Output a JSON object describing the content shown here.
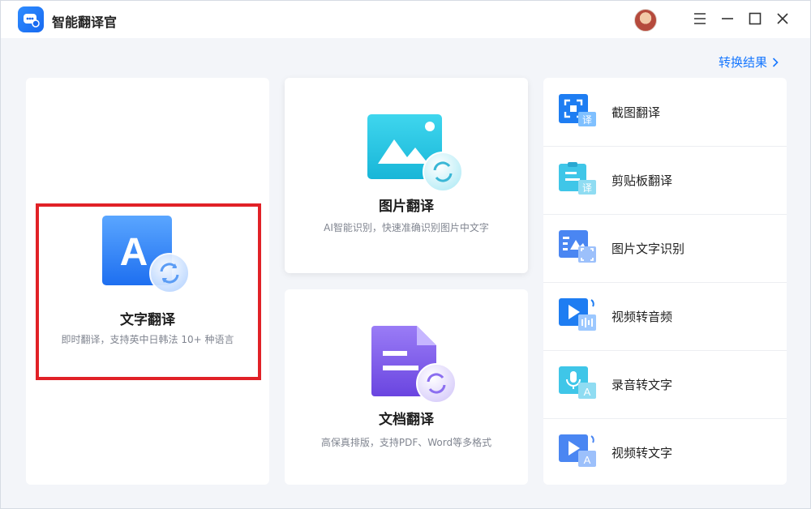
{
  "app": {
    "title": "智能翻译官"
  },
  "header": {
    "result_link": "转换结果"
  },
  "cards": {
    "text": {
      "title": "文字翻译",
      "subtitle": "即时翻译，支持英中日韩法 10+ 种语言"
    },
    "image": {
      "title": "图片翻译",
      "subtitle": "AI智能识别，快速准确识别图片中文字"
    },
    "doc": {
      "title": "文档翻译",
      "subtitle": "高保真排版，支持PDF、Word等多格式"
    }
  },
  "tools": [
    {
      "label": "截图翻译",
      "icon": "screenshot-translate-icon"
    },
    {
      "label": "剪贴板翻译",
      "icon": "clipboard-translate-icon"
    },
    {
      "label": "图片文字识别",
      "icon": "image-ocr-icon"
    },
    {
      "label": "视频转音频",
      "icon": "video-to-audio-icon"
    },
    {
      "label": "录音转文字",
      "icon": "audio-to-text-icon"
    },
    {
      "label": "视频转文字",
      "icon": "video-to-text-icon"
    }
  ],
  "colors": {
    "accent": "#1677ff",
    "highlight": "#e12127"
  }
}
